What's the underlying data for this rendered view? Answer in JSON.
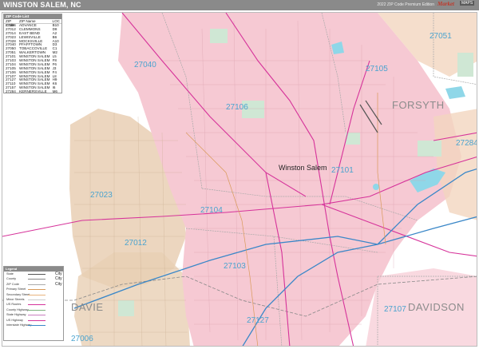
{
  "title": "WINSTON SALEM, NC",
  "edition": "2022 ZIP Code Premium Edition",
  "logo": {
    "brand": "Market",
    "brand2": "MAPS"
  },
  "city_name": "Winston Salem",
  "counties": [
    "FORSYTH",
    "DAVIDSON",
    "DAVIE"
  ],
  "zip_labels": [
    "27051",
    "27040",
    "27105",
    "27106",
    "27101",
    "27284",
    "27023",
    "27104",
    "27012",
    "27103",
    "27107",
    "27127",
    "27006"
  ],
  "zip_table": {
    "header": "ZIP Code List",
    "columns": [
      "ZIP Code",
      "ZIP Name",
      "LOC"
    ],
    "rows": [
      [
        "27006",
        "ADVANCE",
        "B10"
      ],
      [
        "27012",
        "CLEMMONS",
        "D8"
      ],
      [
        "27014",
        "EAST BEND",
        "A2"
      ],
      [
        "27023",
        "LEWISVILLE",
        "B6"
      ],
      [
        "27028",
        "MOCKSVILLE",
        "A10"
      ],
      [
        "27040",
        "PFAFFTOWN",
        "D3"
      ],
      [
        "27050",
        "TOBACCOVILLE",
        "C1"
      ],
      [
        "27051",
        "WALKERTOWN",
        "M2"
      ],
      [
        "27101",
        "WINSTON SALEM",
        "L5"
      ],
      [
        "27103",
        "WINSTON SALEM",
        "F8"
      ],
      [
        "27104",
        "WINSTON SALEM",
        "F6"
      ],
      [
        "27105",
        "WINSTON SALEM",
        "J3"
      ],
      [
        "27106",
        "WINSTON SALEM",
        "F4"
      ],
      [
        "27107",
        "WINSTON SALEM",
        "L8"
      ],
      [
        "27127",
        "WINSTON SALEM",
        "H9"
      ],
      [
        "27110",
        "WINSTON SALEM",
        "K6"
      ],
      [
        "27157",
        "WINSTON SALEM",
        "I6"
      ],
      [
        "27284",
        "KERNERSVILLE",
        "M6"
      ]
    ]
  },
  "legend": {
    "header": "Legend",
    "items": [
      "State",
      "County",
      "ZIP Code",
      "Primary Street",
      "Secondary Street",
      "Minor Streets",
      "US Routes",
      "County Highway",
      "State Highway",
      "US Highway",
      "Interstate Highway"
    ],
    "city_words": [
      "City",
      "City",
      "City"
    ]
  },
  "colors": {
    "pink": "#f6c9d3",
    "tan": "#e9cfb4",
    "green": "#cfe7d4",
    "water": "#8fd7e8",
    "zip_text": "#4aa3cf",
    "highway": "#d6339a",
    "interstate": "#3a87c8"
  }
}
